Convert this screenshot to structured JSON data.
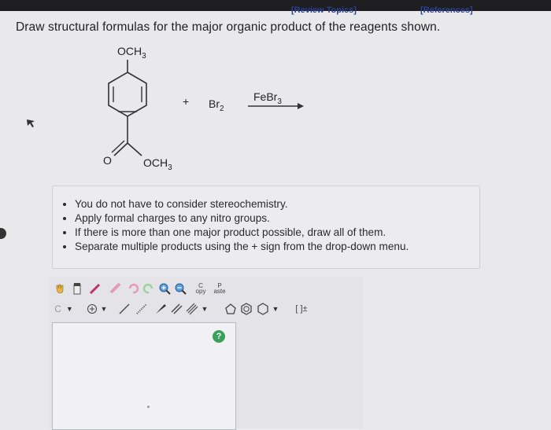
{
  "header": {
    "review_topics": "[Review Topics]",
    "references": "[References]"
  },
  "question": "Draw structural formulas for the major organic product of the reagents shown.",
  "reaction": {
    "substituent_top": "OCH3",
    "ester_o": "O",
    "ester_och3": "OCH3",
    "plus": "+",
    "reagent": "Br2",
    "catalyst": "FeBr3"
  },
  "instructions": [
    "You do not have to consider stereochemistry.",
    "Apply formal charges to any nitro groups.",
    "If there is more than one major product possible, draw all of them.",
    "Separate multiple products using the + sign from the drop-down menu."
  ],
  "toolbar": {
    "copy_label": "C\nopy",
    "paste_label": "P\naste",
    "element_selector": "C",
    "bracket_label": "[ ]±"
  },
  "help_label": "?"
}
